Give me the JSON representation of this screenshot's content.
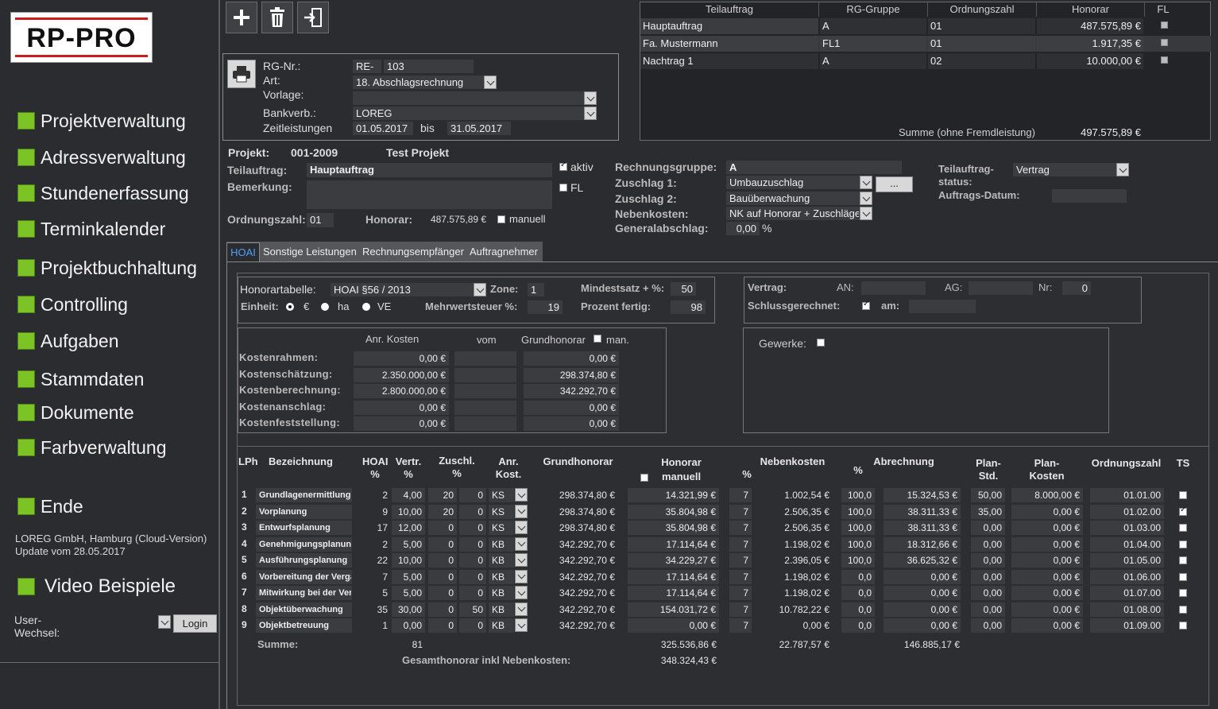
{
  "app": {
    "logo": "RP-PRO"
  },
  "sidebar": {
    "items": [
      {
        "label": "Projektverwaltung"
      },
      {
        "label": "Adressverwaltung"
      },
      {
        "label": "Stundenerfassung"
      },
      {
        "label": "Terminkalender"
      },
      {
        "label": "Projektbuchhaltung"
      },
      {
        "label": "Controlling"
      },
      {
        "label": "Aufgaben"
      },
      {
        "label": "Stammdaten"
      },
      {
        "label": "Dokumente"
      },
      {
        "label": "Farbverwaltung"
      },
      {
        "label": "Ende"
      }
    ],
    "company": "LOREG GmbH, Hamburg  (Cloud-Version)",
    "update": "Update vom 28.05.2017",
    "video": "Video Beispiele",
    "user_label1": "User-",
    "user_label2": "Wechsel:",
    "login": "Login"
  },
  "invoice": {
    "rg_nr_label": "RG-Nr.:",
    "rg_prefix": "RE-",
    "rg_nr": "103",
    "art_label": "Art:",
    "art": "18. Abschlagsrechnung",
    "vorlage_label": "Vorlage:",
    "vorlage": "",
    "bank_label": "Bankverb.:",
    "bank": "LOREG",
    "zeit_label": "Zeitleistungen",
    "zeit_from": "01.05.2017",
    "bis_label": "bis",
    "zeit_to": "31.05.2017"
  },
  "teil_table": {
    "headers": [
      "Teilauftrag",
      "RG-Gruppe",
      "Ordnungszahl",
      "Honorar",
      "FL"
    ],
    "rows": [
      {
        "name": "Hauptauftrag",
        "gruppe": "A",
        "oz": "01",
        "honorar": "487.575,89 €"
      },
      {
        "name": "Fa. Mustermann",
        "gruppe": "FL1",
        "oz": "01",
        "honorar": "1.917,35 €"
      },
      {
        "name": "Nachtrag 1",
        "gruppe": "A",
        "oz": "02",
        "honorar": "10.000,00 €"
      }
    ],
    "sum_label": "Summe (ohne Fremdleistung)",
    "sum": "497.575,89 €"
  },
  "project": {
    "projekt_label": "Projekt:",
    "projekt_nr": "001-2009",
    "projekt_name": "Test Projekt",
    "teil_label": "Teilauftrag:",
    "teil": "Hauptauftrag",
    "aktiv": "aktiv",
    "fl": "FL",
    "bem_label": "Bemerkung:",
    "oz_label": "Ordnungszahl:",
    "oz": "01",
    "honorar_label": "Honorar:",
    "honorar": "487.575,89 €",
    "manuell": "manuell",
    "rg_gruppe_label": "Rechnungsgruppe:",
    "rg_gruppe": "A",
    "zuschlag1_label": "Zuschlag 1:",
    "zuschlag1": "Umbauzuschlag",
    "zuschlag2_label": "Zuschlag 2:",
    "zuschlag2": "Bauüberwachung",
    "neben_label": "Nebenkosten:",
    "neben": "NK auf Honorar + Zuschläge",
    "general_label": "Generalabschlag:",
    "general": "0,00",
    "pct": "%",
    "more": "...",
    "status_label1": "Teilauftrag-",
    "status_label2": "status:",
    "status": "Vertrag",
    "datum_label": "Auftrags-Datum:"
  },
  "tabs": [
    "HOAI",
    "Sonstige Leistungen",
    "Rechnungsempfänger",
    "Auftragnehmer"
  ],
  "hoai": {
    "tabelle_label": "Honorartabelle:",
    "tabelle": "HOAI §56 / 2013",
    "zone_label": "Zone:",
    "zone": "1",
    "mindest_label": "Mindestsatz + %:",
    "mindest": "50",
    "einheit_label": "Einheit:",
    "e1": "€",
    "e2": "ha",
    "e3": "VE",
    "mwst_label": "Mehrwertsteuer %:",
    "mwst": "19",
    "fertig_label": "Prozent fertig:",
    "fertig": "98",
    "vertrag_label": "Vertrag:",
    "an_label": "AN:",
    "ag_label": "AG:",
    "nr_label": "Nr:",
    "nr": "0",
    "schluss_label": "Schlussgerechnet:",
    "am_label": "am:",
    "gewerke_label": "Gewerke:"
  },
  "costs": {
    "headers": [
      "Anr. Kosten",
      "vom",
      "Grundhonorar",
      "man."
    ],
    "rows": [
      {
        "label": "Kostenrahmen:",
        "anr": "0,00 €",
        "grund": "0,00 €"
      },
      {
        "label": "Kostenschätzung:",
        "anr": "2.350.000,00 €",
        "grund": "298.374,80 €"
      },
      {
        "label": "Kostenberechnung:",
        "anr": "2.800.000,00 €",
        "grund": "342.292,70 €"
      },
      {
        "label": "Kostenanschlag:",
        "anr": "0,00 €",
        "grund": "0,00 €"
      },
      {
        "label": "Kostenfeststellung:",
        "anr": "0,00 €",
        "grund": "0,00 €"
      }
    ]
  },
  "lph": {
    "headers": {
      "lph": "LPh",
      "bez": "Bezeichnung",
      "hoai1": "HOAI",
      "hoai2": "%",
      "vertr1": "Vertr.",
      "vertr2": "%",
      "zus1": "Zuschl.",
      "zus2": "%",
      "anr1": "Anr.",
      "anr2": "Kost.",
      "grund": "Grundhonorar",
      "hon1": "Honorar",
      "hon2": "manuell",
      "pct": "%",
      "neben": "Nebenkosten",
      "pct2": "%",
      "abr": "Abrechnung",
      "plan1": "Plan-",
      "plan2": "Std.",
      "pk1": "Plan-",
      "pk2": "Kosten",
      "oz": "Ordnungszahl",
      "ts": "TS"
    },
    "rows": [
      {
        "n": "1",
        "bez": "Grundlagenermittlung",
        "hoai": "2",
        "vertr": "4,00",
        "z1": "20",
        "z2": "0",
        "k": "KS",
        "grund": "298.374,80 €",
        "hon": "14.321,99 €",
        "p": "7",
        "neb": "1.002,54 €",
        "p2": "100,0",
        "abr": "15.324,53 €",
        "std": "50,00",
        "pk": "8.000,00 €",
        "oz": "01.01.00",
        "ts": false
      },
      {
        "n": "2",
        "bez": "Vorplanung",
        "hoai": "9",
        "vertr": "10,00",
        "z1": "20",
        "z2": "0",
        "k": "KS",
        "grund": "298.374,80 €",
        "hon": "35.804,98 €",
        "p": "7",
        "neb": "2.506,35 €",
        "p2": "100,0",
        "abr": "38.311,33 €",
        "std": "35,00",
        "pk": "0,00 €",
        "oz": "01.02.00",
        "ts": true
      },
      {
        "n": "3",
        "bez": "Entwurfsplanung",
        "hoai": "17",
        "vertr": "12,00",
        "z1": "0",
        "z2": "0",
        "k": "KS",
        "grund": "298.374,80 €",
        "hon": "35.804,98 €",
        "p": "7",
        "neb": "2.506,35 €",
        "p2": "100,0",
        "abr": "38.311,33 €",
        "std": "0,00",
        "pk": "0,00 €",
        "oz": "01.03.00",
        "ts": false
      },
      {
        "n": "4",
        "bez": "Genehmigungsplanung",
        "hoai": "2",
        "vertr": "5,00",
        "z1": "0",
        "z2": "0",
        "k": "KB",
        "grund": "342.292,70 €",
        "hon": "17.114,64 €",
        "p": "7",
        "neb": "1.198,02 €",
        "p2": "100,0",
        "abr": "18.312,66 €",
        "std": "0,00",
        "pk": "0,00 €",
        "oz": "01.04.00",
        "ts": false
      },
      {
        "n": "5",
        "bez": "Ausführungsplanung",
        "hoai": "22",
        "vertr": "10,00",
        "z1": "0",
        "z2": "0",
        "k": "KB",
        "grund": "342.292,70 €",
        "hon": "34.229,27 €",
        "p": "7",
        "neb": "2.396,05 €",
        "p2": "100,0",
        "abr": "36.625,32 €",
        "std": "0,00",
        "pk": "0,00 €",
        "oz": "01.05.00",
        "ts": false
      },
      {
        "n": "6",
        "bez": "Vorbereitung der Vergat",
        "hoai": "7",
        "vertr": "5,00",
        "z1": "0",
        "z2": "0",
        "k": "KB",
        "grund": "342.292,70 €",
        "hon": "17.114,64 €",
        "p": "7",
        "neb": "1.198,02 €",
        "p2": "0,0",
        "abr": "0,00 €",
        "std": "0,00",
        "pk": "0,00 €",
        "oz": "01.06.00",
        "ts": false
      },
      {
        "n": "7",
        "bez": "Mitwirkung bei der Verga",
        "hoai": "5",
        "vertr": "5,00",
        "z1": "0",
        "z2": "0",
        "k": "KB",
        "grund": "342.292,70 €",
        "hon": "17.114,64 €",
        "p": "7",
        "neb": "1.198,02 €",
        "p2": "0,0",
        "abr": "0,00 €",
        "std": "0,00",
        "pk": "0,00 €",
        "oz": "01.07.00",
        "ts": false
      },
      {
        "n": "8",
        "bez": "Objektüberwachung",
        "hoai": "35",
        "vertr": "30,00",
        "z1": "0",
        "z2": "50",
        "k": "KB",
        "grund": "342.292,70 €",
        "hon": "154.031,72 €",
        "p": "7",
        "neb": "10.782,22 €",
        "p2": "0,0",
        "abr": "0,00 €",
        "std": "0,00",
        "pk": "0,00 €",
        "oz": "01.08.00",
        "ts": false
      },
      {
        "n": "9",
        "bez": "Objektbetreuung",
        "hoai": "1",
        "vertr": "0,00",
        "z1": "0",
        "z2": "0",
        "k": "KB",
        "grund": "342.292,70 €",
        "hon": "0,00 €",
        "p": "7",
        "neb": "0,00 €",
        "p2": "0,0",
        "abr": "0,00 €",
        "std": "0,00",
        "pk": "0,00 €",
        "oz": "01.09.00",
        "ts": false
      }
    ],
    "sum_label": "Summe:",
    "sum_vertr": "81",
    "sum_hon": "325.536,86 €",
    "sum_neb": "22.787,57 €",
    "sum_abr": "146.885,17 €",
    "gesamt_label": "Gesamthonorar inkl Nebenkosten:",
    "gesamt": "348.324,43 €"
  }
}
